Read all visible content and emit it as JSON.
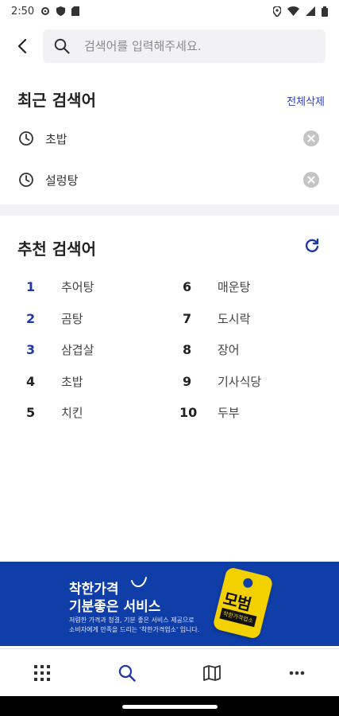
{
  "status_bar": {
    "time": "2:50"
  },
  "search": {
    "placeholder": "검색어를 입력해주세요."
  },
  "recent": {
    "title": "최근 검색어",
    "clear_all": "전체삭제",
    "items": [
      {
        "label": "초밥"
      },
      {
        "label": "설렁탕"
      }
    ]
  },
  "recommended": {
    "title": "추천 검색어",
    "left": [
      {
        "rank": "1",
        "label": "추어탕"
      },
      {
        "rank": "2",
        "label": "곰탕"
      },
      {
        "rank": "3",
        "label": "삼겹살"
      },
      {
        "rank": "4",
        "label": "초밥"
      },
      {
        "rank": "5",
        "label": "치킨"
      }
    ],
    "right": [
      {
        "rank": "6",
        "label": "매운탕"
      },
      {
        "rank": "7",
        "label": "도시락"
      },
      {
        "rank": "8",
        "label": "장어"
      },
      {
        "rank": "9",
        "label": "기사식당"
      },
      {
        "rank": "10",
        "label": "두부"
      }
    ]
  },
  "banner": {
    "title_line1": "착한가격",
    "title_line2": "기분좋은 서비스",
    "desc_line1": "저렴한 가격과 청결, 기분 좋은 서비스 제공으로",
    "desc_line2": "소비자에게 만족을 드리는 '착한가격업소' 입니다.",
    "tag_text": "모범",
    "tag_sub": "착한가격업소"
  },
  "colors": {
    "accent": "#1f37a8",
    "banner_bg": "#0f3ea8",
    "tag": "#f3d100"
  }
}
